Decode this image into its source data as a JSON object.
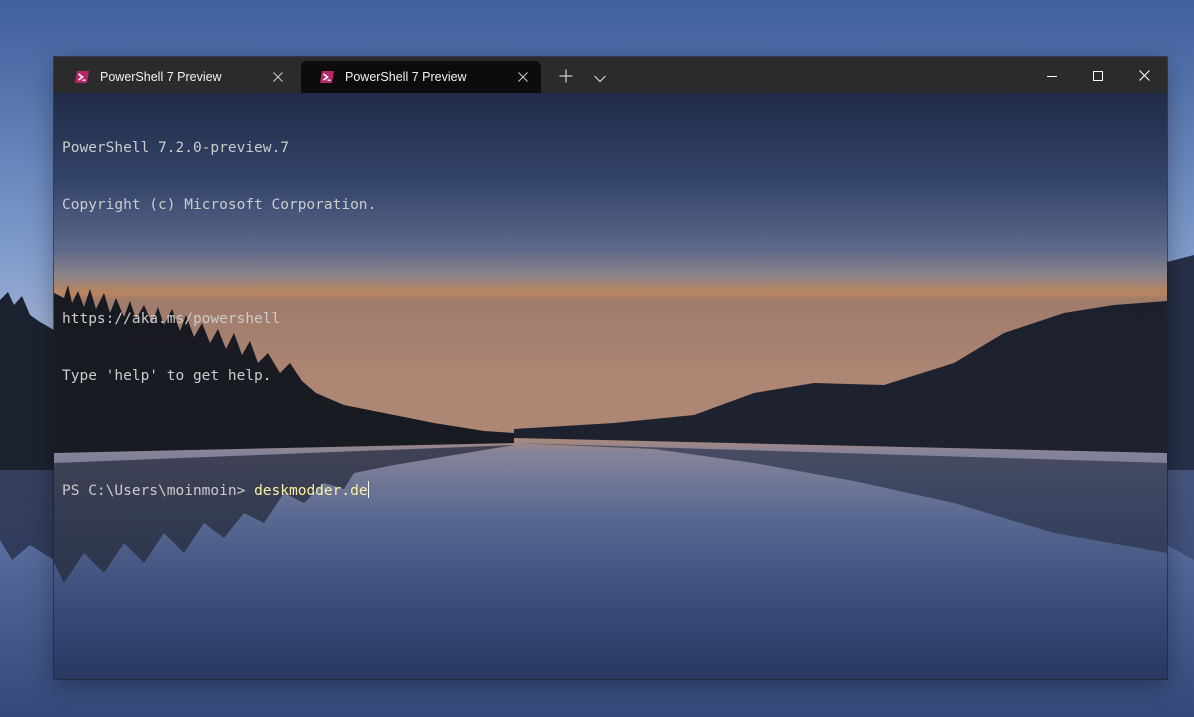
{
  "tabs": [
    {
      "label": "PowerShell 7 Preview",
      "active": false,
      "icon": "powershell-icon"
    },
    {
      "label": "PowerShell 7 Preview",
      "active": true,
      "icon": "powershell-icon"
    }
  ],
  "titlebar": {
    "new_tab_icon": "plus-icon",
    "dropdown_icon": "chevron-down-icon",
    "minimize_icon": "minimize-icon",
    "maximize_icon": "maximize-icon",
    "close_icon": "close-icon"
  },
  "terminal": {
    "lines": [
      "PowerShell 7.2.0-preview.7",
      "Copyright (c) Microsoft Corporation.",
      "",
      "https://aka.ms/powershell",
      "Type 'help' to get help.",
      ""
    ],
    "prompt": "PS C:\\Users\\moinmoin> ",
    "command": "deskmodder.de"
  },
  "colors": {
    "titlebar": "#2b2b2b",
    "active_tab": "#0c0c0c",
    "terminal_text": "#cccccc",
    "command_text": "#f9f1a5"
  }
}
